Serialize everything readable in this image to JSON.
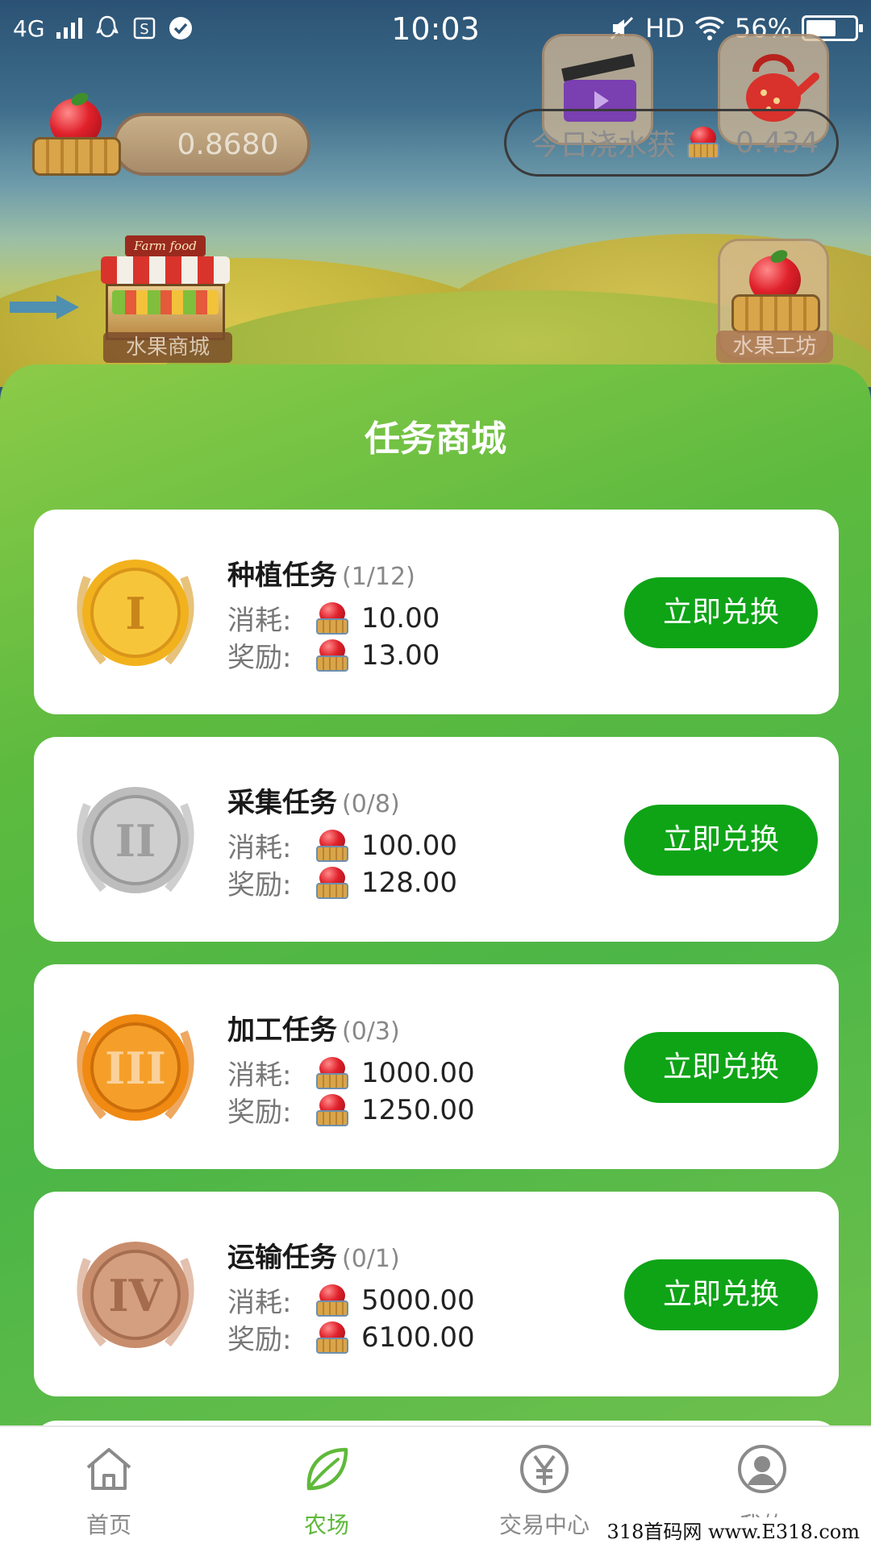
{
  "status_bar": {
    "network": "4G",
    "time": "10:03",
    "hd": "HD",
    "battery": "56%"
  },
  "top": {
    "balance": "0.8680",
    "today_label": "今日浇水获",
    "today_value": "0.434",
    "market_label": "水果商城",
    "market_sign": "Farm food",
    "workshop_label": "水果工坊"
  },
  "panel": {
    "title": "任务商城",
    "consume_label": "消耗:",
    "reward_label": "奖励:",
    "tasks": [
      {
        "name": "种植任务",
        "progress": "(1/12)",
        "consume": "10.00",
        "reward": "13.00",
        "button": "立即兑换",
        "medal": "I",
        "medal_color": "#f2b21d"
      },
      {
        "name": "采集任务",
        "progress": "(0/8)",
        "consume": "100.00",
        "reward": "128.00",
        "button": "立即兑换",
        "medal": "II",
        "medal_color": "#bdbdbd"
      },
      {
        "name": "加工任务",
        "progress": "(0/3)",
        "consume": "1000.00",
        "reward": "1250.00",
        "button": "立即兑换",
        "medal": "III",
        "medal_color": "#f08a12"
      },
      {
        "name": "运输任务",
        "progress": "(0/1)",
        "consume": "5000.00",
        "reward": "6100.00",
        "button": "立即兑换",
        "medal": "IV",
        "medal_color": "#c88d6c"
      }
    ]
  },
  "nav": {
    "items": [
      {
        "label": "首页",
        "icon": "home-icon"
      },
      {
        "label": "农场",
        "icon": "leaf-icon"
      },
      {
        "label": "交易中心",
        "icon": "yen-icon"
      },
      {
        "label": "我的",
        "icon": "user-icon"
      }
    ],
    "active_index": 1,
    "active_color": "#5fb93a"
  },
  "watermark": "318首码网 www.E318.com"
}
